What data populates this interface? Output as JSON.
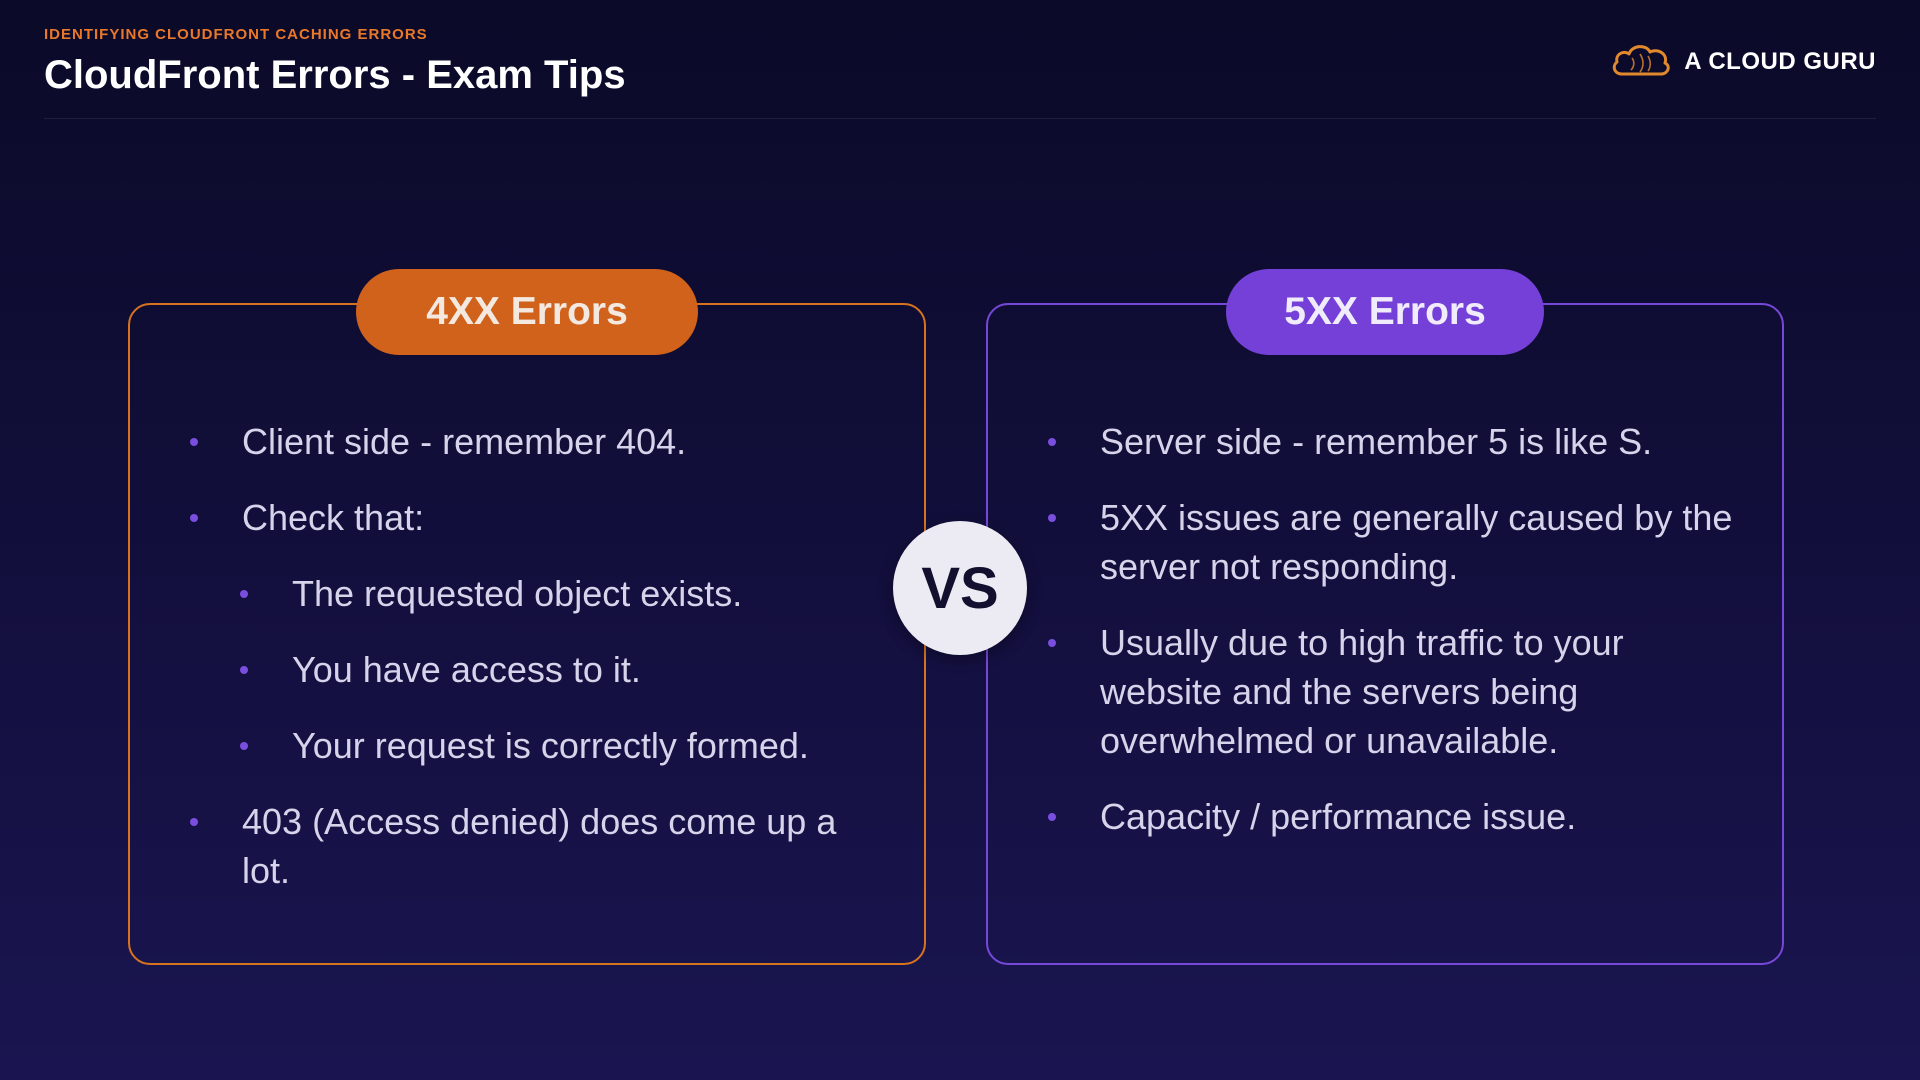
{
  "header": {
    "eyebrow": "IDENTIFYING CLOUDFRONT CACHING ERRORS",
    "title": "CloudFront Errors - Exam Tips"
  },
  "brand": {
    "name": "A CLOUD GURU",
    "icon": "cloud-logo-icon"
  },
  "vs_label": "VS",
  "cards": {
    "left": {
      "title": "4XX Errors",
      "items": [
        "Client side - remember 404.",
        "Check that:",
        "The requested object exists.",
        "You have access to it.",
        "Your request is correctly formed.",
        "403 (Access denied) does come up a lot."
      ]
    },
    "right": {
      "title": "5XX Errors",
      "items": [
        "Server side - remember 5 is like S.",
        "5XX issues are generally caused by the server not responding.",
        "Usually due to high traffic to your website and the servers being overwhelmed or unavailable.",
        "Capacity / performance issue."
      ]
    }
  },
  "colors": {
    "accent_orange": "#d0621b",
    "accent_purple": "#7540d8",
    "background": "#100d36",
    "bullet": "#7a4fe0"
  }
}
